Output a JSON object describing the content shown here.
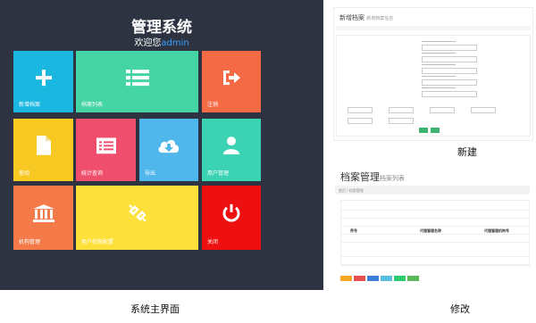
{
  "dashboard": {
    "title": "管理系统",
    "welcome_prefix": "欢迎您",
    "user": "admin",
    "tiles": [
      {
        "label": "新增档案",
        "icon": "plus-icon",
        "color": "#1ab8e0"
      },
      {
        "label": "档案列表",
        "icon": "list-icon",
        "color": "#45d4a4"
      },
      {
        "label": "注销",
        "icon": "logout-icon",
        "color": "#f46a45"
      },
      {
        "label": "查阅",
        "icon": "document-icon",
        "color": "#f8c823"
      },
      {
        "label": "统计查询",
        "icon": "form-icon",
        "color": "#ef4e6c"
      },
      {
        "label": "导出",
        "icon": "cloud-download-icon",
        "color": "#4fb7ec"
      },
      {
        "label": "用户管理",
        "icon": "user-icon",
        "color": "#3bd3b3"
      },
      {
        "label": "机构管理",
        "icon": "bank-icon",
        "color": "#f47a4a"
      },
      {
        "label": "用户权限配置",
        "icon": "unlink-icon",
        "color": "#fde13a"
      },
      {
        "label": "关闭",
        "icon": "power-icon",
        "color": "#ee1010"
      }
    ]
  },
  "captions": {
    "main": "系统主界面",
    "new": "新建",
    "edit": "修改"
  },
  "new_panel": {
    "title": "新增档案",
    "subtitle": "新增档案信息"
  },
  "list_panel": {
    "title": "档案管理",
    "subtitle": "档案列表",
    "breadcrumb": "首页 / 档案管理",
    "table_header": [
      "序号",
      "代理管理名称",
      "代理管理机构号"
    ]
  },
  "colors": {
    "bg": "#2d3340",
    "accent": "#3aa0ff"
  }
}
